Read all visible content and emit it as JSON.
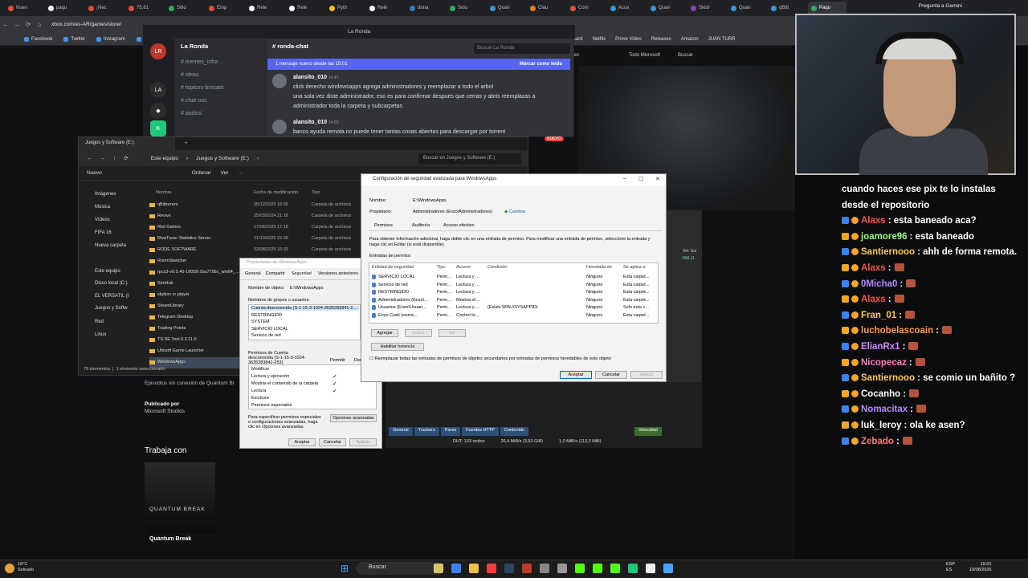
{
  "browser": {
    "tabs": [
      "Nuev",
      "paqu",
      "¡Nec",
      "75.61",
      "Sitio",
      "Emp",
      "Rele",
      "Rele",
      "Pyth",
      "Rele",
      "dona",
      "Solu",
      "Quan",
      "Clau",
      "Com",
      "Acce",
      "Quan",
      "Skidr",
      "Quan",
      "qBitt",
      "Paqu"
    ],
    "gemini": "Pregunta a Gemini",
    "url": "xbox.com/es-AR/games/store/",
    "bookmarks": [
      "Facebook",
      "Twitter",
      "Instagram",
      "You"
    ],
    "right_bookmarks": [
      "CS 1.6 | Dashboard",
      "Netflix",
      "Prime Video",
      "Releases",
      "Amazon",
      "JUAN TURR"
    ]
  },
  "xbox": {
    "nav": [
      "lladores",
      "Todo Microsoft",
      "Buscar"
    ],
    "offline": "Episodios sin conexión de Quantum Br",
    "published_label": "Publicado por",
    "publisher": "Microsoft Studios",
    "trabaja": "Trabaja con",
    "card_logo": "QUANTUM BREAK",
    "game_title": "Quantum Break"
  },
  "discord": {
    "window_title": "La Ronda",
    "server": "La Ronda",
    "channel": "ronda-chat",
    "channels": [
      "memes_infra",
      "ideas",
      "topicos-brocast",
      "chat-ooc",
      "audios"
    ],
    "new_messages": "1 mensaje nuevo desde las 15:01",
    "mark_read": "Marcar como leído",
    "search": "Buscar La Ronda",
    "new_badge": "NUEVO",
    "messages": [
      {
        "user": "alansito_010",
        "time": "14:47",
        "lines": [
          "click derecho windowsapps agrega administradores y reemplazar a todo el arbol",
          "una sola vez diste administrador, eso es para confirmar despues que cerras y abris reemplazas a administrador toda la carpeta y subcarpetas"
        ]
      },
      {
        "user": "alansito_010",
        "time": "14:59",
        "lines": [
          "banco ayuda remota no puede tener tantas cosas abiertas para descargar por torrent"
        ]
      }
    ]
  },
  "explorer": {
    "tab": "Juegos y Software (E:)",
    "breadcrumb": [
      "Este equipo",
      "Juegos y Software (E:)"
    ],
    "search": "Buscar en Juegos y Software (E:)",
    "toolbar": [
      "Nuevo",
      "Ordenar",
      "Ver"
    ],
    "nav": [
      "Imágenes",
      "Música",
      "Vídeos",
      "FIFA 16",
      "Nueva carpeta",
      "Este equipo",
      "Disco local (C:)",
      "EL VERSATIL (I",
      "Juegos y Softw",
      "Red",
      "Linux"
    ],
    "columns": [
      "Nombre",
      "Fecha de modificación",
      "Tipo"
    ],
    "files": [
      {
        "name": "qBittorrent",
        "date": "05/12/2025 16:05",
        "type": "Carpeta de archivos"
      },
      {
        "name": "Revive",
        "date": "25/03/2024 21:18",
        "type": "Carpeta de archivos"
      },
      {
        "name": "Riot Games",
        "date": "17/08/2026 17:18",
        "type": "Carpeta de archivos"
      },
      {
        "name": "RivaTuner Statistics Server",
        "date": "21/10/2025 22:39",
        "type": "Carpeta de archivos"
      },
      {
        "name": "RODE SOFTWARE",
        "date": "02/08/2025 16:33",
        "type": "Carpeta de archivos"
      },
      {
        "name": "RoomSketcher",
        "date": "",
        "type": ""
      },
      {
        "name": "rpcs3-v0.0.40-19058-2ba7756c_win64_...",
        "date": "",
        "type": ""
      },
      {
        "name": "SimHub",
        "date": "",
        "type": ""
      },
      {
        "name": "skybox vr player",
        "date": "",
        "type": ""
      },
      {
        "name": "SteamLibrary",
        "date": "",
        "type": ""
      },
      {
        "name": "Telegram Desktop",
        "date": "",
        "type": ""
      },
      {
        "name": "Trading Points",
        "date": "",
        "type": ""
      },
      {
        "name": "TS.SE.Tool.0.3.11.0",
        "date": "",
        "type": ""
      },
      {
        "name": "Ubisoft Game Launcher",
        "date": "",
        "type": ""
      },
      {
        "name": "WindowsApps",
        "date": "",
        "type": ""
      }
    ],
    "status": [
      "79 elementos",
      "1 elemento seleccionado"
    ]
  },
  "props": {
    "title": "Propiedades de WindowsApps",
    "tabs": [
      "General",
      "Compartir",
      "Seguridad",
      "Versiones anteriores",
      "Per"
    ],
    "object_label": "Nombre de objeto:",
    "object": "E:\\WindowsApps",
    "groups_label": "Nombres de grupos o usuarios:",
    "groups": [
      "Cuenta desconocida (S-1-15-3-1024-3635283841-2530",
      "RESTRINGIDO",
      "SYSTEM",
      "SERVICIO LOCAL",
      "Servicio de red"
    ],
    "perm_label": "Permisos de Cuenta desconocida (S-1-15-3-1024-3635283841-253(",
    "perm_cols": [
      "Permitir",
      "Den"
    ],
    "perms": [
      "Modificar",
      "Lectura y ejecución",
      "Mostrar el contenido de la carpeta",
      "Lectura",
      "Escritura",
      "Permisos especiales"
    ],
    "checks": [
      "",
      "✓",
      "✓",
      "✓",
      "",
      ""
    ],
    "advanced_text": "Para especificar permisos especiales o configuraciones avanzadas, haga clic en Opciones avanzadas.",
    "advanced_btn": "Opciones avanzadas",
    "buttons": [
      "Aceptar",
      "Cancelar",
      "Aplicar"
    ]
  },
  "adv": {
    "title": "Configuración de seguridad avanzada para WindowsApps",
    "name_label": "Nombre:",
    "name": "E:\\WindowsApps",
    "owner_label": "Propietario:",
    "owner": "Administradores (Enzo\\Administradores)",
    "change": "Cambiar",
    "tabs": [
      "Permisos",
      "Auditoría",
      "Acceso efectivo"
    ],
    "info": "Para obtener información adicional, haga doble clic en una entrada de permiso. Para modificar una entrada de permiso, seleccione la entrada y haga clic en Editar (si está disponible).",
    "entries_label": "Entradas de permiso:",
    "columns": [
      "Entidad de seguridad",
      "Tipo",
      "Acceso",
      "Condición",
      "Heredada de",
      "Se aplica a"
    ],
    "rows": [
      [
        "SERVICIO LOCAL",
        "Perm...",
        "Lectura y ...",
        "",
        "Ninguno",
        "Esta carpet..."
      ],
      [
        "Servicio de red",
        "Perm...",
        "Lectura y ...",
        "",
        "Ninguno",
        "Esta carpet..."
      ],
      [
        "RESTRINGIDO",
        "Perm...",
        "Lectura y ...",
        "",
        "Ninguno",
        "Esta carpet..."
      ],
      [
        "Administradores (Enzo\\...",
        "Perm...",
        "Mostrar el ...",
        "",
        "Ninguno",
        "Esta carpet..."
      ],
      [
        "Usuarios (Enzo\\Usuari...",
        "Perm...",
        "Lectura y ...",
        "(Exists WIN://SYSAPPID)",
        "Ninguno",
        "Solo esta c..."
      ],
      [
        "Enzo Cueli (enzoc...",
        "Perm...",
        "Control to...",
        "",
        "Ninguno",
        "Esta carpet..."
      ]
    ],
    "actions": [
      "Agregar",
      "Quitar",
      "Ver"
    ],
    "inherit_btn": "Habilitar herencia",
    "replace": "Reemplazar todas las entradas de permisos de objetos secundarios por entradas de permisos heredables de este objeto",
    "buttons": [
      "Aceptar",
      "Cancelar",
      "Aplicar"
    ]
  },
  "torrent": {
    "tabs": [
      "General",
      "Trackers",
      "Pares",
      "Fuentes HTTP",
      "Contenido",
      "Velocidad"
    ],
    "status": [
      "DHT: 133 nodos",
      "26,4 MiB/s (3,93 GiB)",
      "1,0 MiB/s (113,3 MiB)"
    ],
    "side": [
      "Vel. Sul",
      "868,11"
    ]
  },
  "chat": [
    {
      "user": "",
      "text": "cuando haces ese pix te lo instalas",
      "color": "#ffffff"
    },
    {
      "user": "",
      "text": "desde el repositorio",
      "color": "#ffffff"
    },
    {
      "user": "Alaxs",
      "text": ": esta baneado aca?",
      "color": "#ff4d4d"
    },
    {
      "user": "joamore96",
      "text": ": esta baneado",
      "color": "#9bff7a"
    },
    {
      "user": "Santiernooo",
      "text": ": ahh de forma remota.",
      "color": "#ffc94d"
    },
    {
      "user": "Alaxs",
      "text": ":",
      "color": "#ff4d4d"
    },
    {
      "user": "0Micha0",
      "text": ":",
      "color": "#b38cff"
    },
    {
      "user": "Alaxs",
      "text": ":",
      "color": "#ff4d4d"
    },
    {
      "user": "Fran_01",
      "text": ":",
      "color": "#ffc94d"
    },
    {
      "user": "luchobelascoain",
      "text": ":",
      "color": "#ff9a4d"
    },
    {
      "user": "ElianRx1",
      "text": ":",
      "color": "#d08cff"
    },
    {
      "user": "Nicopecaz",
      "text": ":",
      "color": "#ff7ab8"
    },
    {
      "user": "Santiernooo",
      "text": ": se comio un bañito ?",
      "color": "#ffc94d"
    },
    {
      "user": "Cocanho",
      "text": ":",
      "color": "#ffffff"
    },
    {
      "user": "Nomacitax",
      "text": ":",
      "color": "#b38cff"
    },
    {
      "user": "luk_leroy",
      "text": ": ola ke asen?",
      "color": "#ffffff"
    },
    {
      "user": "Zebado",
      "text": ":",
      "color": "#ff7a7a"
    }
  ],
  "taskbar": {
    "temp": "18°C",
    "weather": "Soleado",
    "search": "Buscar",
    "lang": [
      "ESP",
      "ES"
    ],
    "time": "15:01",
    "date": "19/08/2026"
  }
}
